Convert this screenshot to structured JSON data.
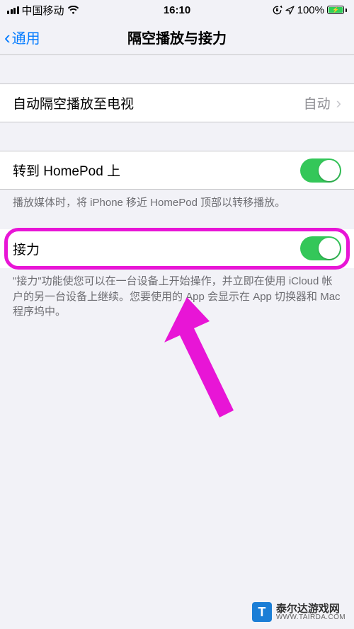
{
  "status": {
    "carrier": "中国移动",
    "time": "16:10",
    "battery_pct": "100%"
  },
  "nav": {
    "back_label": "通用",
    "title": "隔空播放与接力"
  },
  "cells": {
    "airplay_tv": {
      "title": "自动隔空播放至电视",
      "value": "自动"
    },
    "homepod": {
      "title": "转到 HomePod 上",
      "footer": "播放媒体时，将 iPhone 移近 HomePod 顶部以转移播放。",
      "checked": true
    },
    "handoff": {
      "title": "接力",
      "footer": "\"接力\"功能使您可以在一台设备上开始操作，并立即在使用 iCloud 帐户的另一台设备上继续。您要使用的 App 会显示在 App 切换器和 Mac 程序坞中。",
      "checked": true
    }
  },
  "watermark": {
    "name": "泰尔达游戏网",
    "url": "WWW.TAIRDA.COM"
  },
  "icons": {
    "signal": "signal-icon",
    "wifi": "wifi-icon",
    "lock": "lock-rotation-icon",
    "location": "location-icon",
    "battery": "battery-icon",
    "chevron_left": "chevron-left-icon",
    "chevron_right": "chevron-right-icon"
  }
}
